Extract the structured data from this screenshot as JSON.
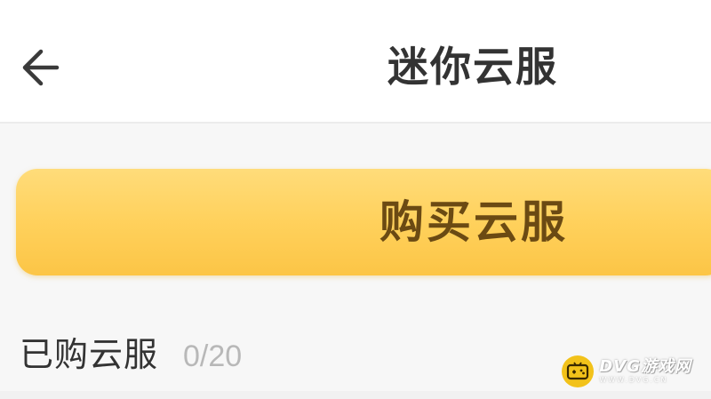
{
  "header": {
    "title": "迷你云服",
    "back_icon": "arrow-left-icon"
  },
  "buy_button": {
    "label": "购买云服",
    "color": "#ffd15c"
  },
  "purchased_section": {
    "title": "已购云服",
    "count": "0/20"
  },
  "watermark": {
    "brand": "DVG游戏网",
    "url": "WWW.DVG.CN",
    "icon": "gamepad-icon",
    "color": "#f2c21a"
  }
}
